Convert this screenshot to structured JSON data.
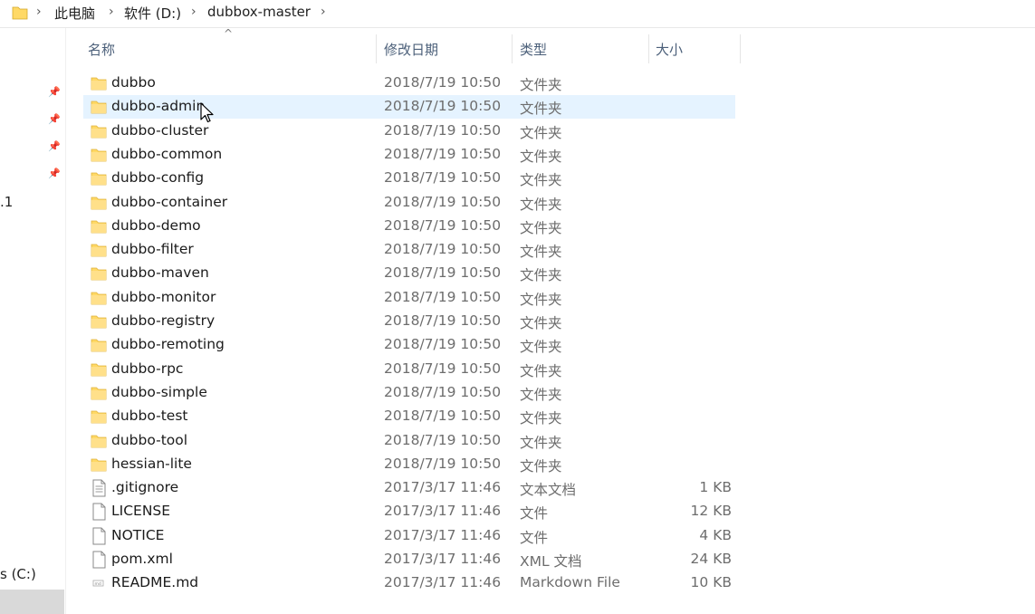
{
  "address_bar": {
    "crumbs": [
      "此电脑",
      "软件 (D:)",
      "dubbox-master"
    ]
  },
  "nav": {
    "partial_labels": [
      ".1",
      "s (C:)"
    ]
  },
  "columns": {
    "name": "名称",
    "modified": "修改日期",
    "type": "类型",
    "size": "大小"
  },
  "files": [
    {
      "name": "dubbo",
      "date": "2018/7/19 10:50",
      "type": "文件夹",
      "size": "",
      "icon": "folder-icon"
    },
    {
      "name": "dubbo-admin",
      "date": "2018/7/19 10:50",
      "type": "文件夹",
      "size": "",
      "icon": "folder-icon"
    },
    {
      "name": "dubbo-cluster",
      "date": "2018/7/19 10:50",
      "type": "文件夹",
      "size": "",
      "icon": "folder-icon"
    },
    {
      "name": "dubbo-common",
      "date": "2018/7/19 10:50",
      "type": "文件夹",
      "size": "",
      "icon": "folder-icon"
    },
    {
      "name": "dubbo-config",
      "date": "2018/7/19 10:50",
      "type": "文件夹",
      "size": "",
      "icon": "folder-icon"
    },
    {
      "name": "dubbo-container",
      "date": "2018/7/19 10:50",
      "type": "文件夹",
      "size": "",
      "icon": "folder-icon"
    },
    {
      "name": "dubbo-demo",
      "date": "2018/7/19 10:50",
      "type": "文件夹",
      "size": "",
      "icon": "folder-icon"
    },
    {
      "name": "dubbo-filter",
      "date": "2018/7/19 10:50",
      "type": "文件夹",
      "size": "",
      "icon": "folder-icon"
    },
    {
      "name": "dubbo-maven",
      "date": "2018/7/19 10:50",
      "type": "文件夹",
      "size": "",
      "icon": "folder-icon"
    },
    {
      "name": "dubbo-monitor",
      "date": "2018/7/19 10:50",
      "type": "文件夹",
      "size": "",
      "icon": "folder-icon"
    },
    {
      "name": "dubbo-registry",
      "date": "2018/7/19 10:50",
      "type": "文件夹",
      "size": "",
      "icon": "folder-icon"
    },
    {
      "name": "dubbo-remoting",
      "date": "2018/7/19 10:50",
      "type": "文件夹",
      "size": "",
      "icon": "folder-icon"
    },
    {
      "name": "dubbo-rpc",
      "date": "2018/7/19 10:50",
      "type": "文件夹",
      "size": "",
      "icon": "folder-icon"
    },
    {
      "name": "dubbo-simple",
      "date": "2018/7/19 10:50",
      "type": "文件夹",
      "size": "",
      "icon": "folder-icon"
    },
    {
      "name": "dubbo-test",
      "date": "2018/7/19 10:50",
      "type": "文件夹",
      "size": "",
      "icon": "folder-icon"
    },
    {
      "name": "dubbo-tool",
      "date": "2018/7/19 10:50",
      "type": "文件夹",
      "size": "",
      "icon": "folder-icon"
    },
    {
      "name": "hessian-lite",
      "date": "2018/7/19 10:50",
      "type": "文件夹",
      "size": "",
      "icon": "folder-icon"
    },
    {
      "name": ".gitignore",
      "date": "2017/3/17 11:46",
      "type": "文本文档",
      "size": "1 KB",
      "icon": "text-file-icon"
    },
    {
      "name": "LICENSE",
      "date": "2017/3/17 11:46",
      "type": "文件",
      "size": "12 KB",
      "icon": "blank-file-icon"
    },
    {
      "name": "NOTICE",
      "date": "2017/3/17 11:46",
      "type": "文件",
      "size": "4 KB",
      "icon": "blank-file-icon"
    },
    {
      "name": "pom.xml",
      "date": "2017/3/17 11:46",
      "type": "XML 文档",
      "size": "24 KB",
      "icon": "xml-file-icon"
    },
    {
      "name": "README.md",
      "date": "2017/3/17 11:46",
      "type": "Markdown File",
      "size": "10 KB",
      "icon": "markdown-file-icon"
    }
  ],
  "colors": {
    "folder_yellow": "#ffd966",
    "folder_yellow_dark": "#e8b82e",
    "hover_row": "#e5f3ff",
    "header_text": "#4c607a"
  }
}
